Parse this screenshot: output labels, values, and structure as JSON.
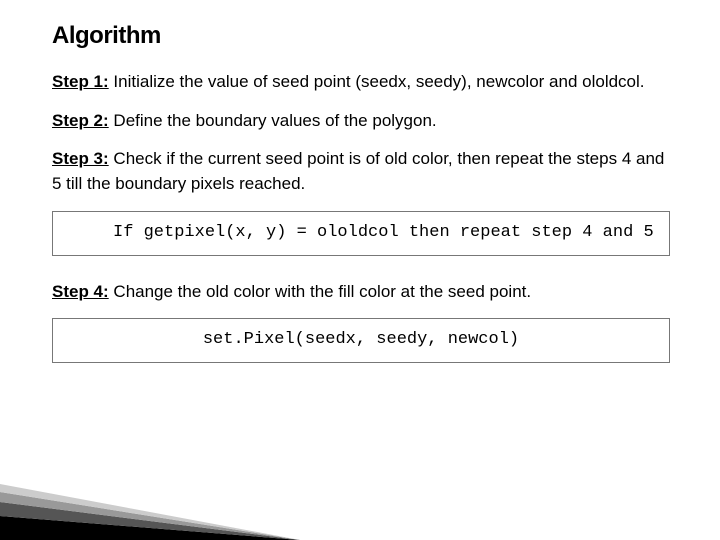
{
  "title": "Algorithm",
  "steps": {
    "s1": {
      "label": "Step 1:",
      "text": " Initialize the value of seed point (seedx, seedy), newcolor and ololdcol."
    },
    "s2": {
      "label": "Step 2:",
      "text": " Define the boundary values of the polygon."
    },
    "s3": {
      "label": "Step 3:",
      "text": " Check if the current seed point is of old color, then repeat the steps 4 and  5 till the boundary pixels reached."
    },
    "s4": {
      "label": "Step 4:",
      "text": " Change the old color with the fill color at the seed point."
    }
  },
  "code": {
    "c1": "If getpixel(x, y) = ololdcol then repeat step 4 and 5",
    "c2": "set.Pixel(seedx, seedy, newcol)"
  }
}
